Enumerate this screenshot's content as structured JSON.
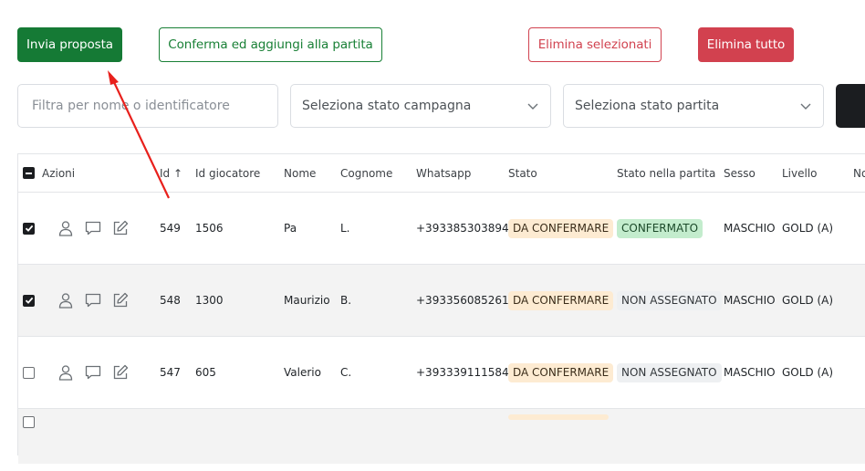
{
  "toolbar": {
    "send_label": "Invia proposta",
    "confirm_label": "Conferma ed aggiungi alla partita",
    "delete_selected_label": "Elimina selezionati",
    "delete_all_label": "Elimina tutto"
  },
  "filters": {
    "search_placeholder": "Filtra per nome o identificatore",
    "campaign_status": "Seleziona stato campagna",
    "match_status": "Seleziona stato partita"
  },
  "table": {
    "columns": [
      "Azioni",
      "Id",
      "Id giocatore",
      "Nome",
      "Cognome",
      "Whatsapp",
      "Stato",
      "Stato nella partita",
      "Sesso",
      "Livello",
      "No"
    ],
    "sort_indicator": "↑",
    "rows": [
      {
        "checked": true,
        "id": "549",
        "player_id": "1506",
        "name": "Pa",
        "surname": "L.",
        "whatsapp": "+393385303894",
        "status": "DA CONFERMARE",
        "match_status": "CONFERMATO",
        "sex": "MASCHIO",
        "level": "GOLD (A)"
      },
      {
        "checked": true,
        "id": "548",
        "player_id": "1300",
        "name": "Maurizio",
        "surname": "B.",
        "whatsapp": "+393356085261",
        "status": "DA CONFERMARE",
        "match_status": "NON ASSEGNATO",
        "sex": "MASCHIO",
        "level": "GOLD (A)"
      },
      {
        "checked": false,
        "id": "547",
        "player_id": "605",
        "name": "Valerio",
        "surname": "C.",
        "whatsapp": "+393339111584",
        "status": "DA CONFERMARE",
        "match_status": "NON ASSEGNATO",
        "sex": "MASCHIO",
        "level": "GOLD (A)"
      }
    ]
  },
  "colors": {
    "primary_green": "#157a35",
    "danger_red": "#d2414f",
    "annotation_arrow": "#e8201c"
  }
}
